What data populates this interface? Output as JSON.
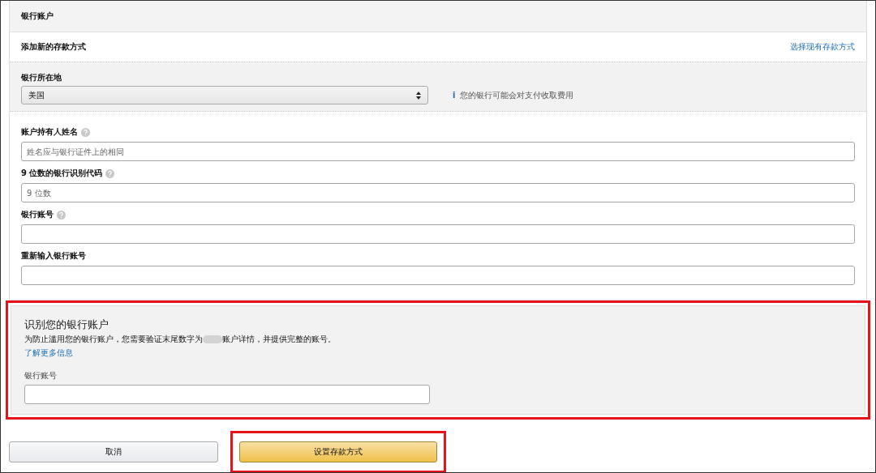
{
  "panel": {
    "title": "银行账户"
  },
  "method": {
    "title": "添加新的存款方式",
    "link": "选择现有存款方式"
  },
  "location": {
    "label": "银行所在地",
    "value": "美国",
    "note_icon": "i",
    "note": "您的银行可能会对支付收取费用"
  },
  "fields": [
    {
      "label": "账户持有人姓名",
      "help": true,
      "placeholder": "姓名应与银行证件上的相同"
    },
    {
      "label": "9 位数的银行识别代码",
      "help": true,
      "placeholder": "9 位数"
    },
    {
      "label": "银行账号",
      "help": true
    },
    {
      "label": "重新输入银行账号",
      "help": false
    }
  ],
  "verify": {
    "title": "识别您的银行账户",
    "text_before": "为防止滥用您的银行账户，您需要验证末尾数字为",
    "text_after": "账户详情，并提供完整的账号。",
    "link": "了解更多信息",
    "field_label": "银行账号",
    "highlighted": true
  },
  "buttons": [
    {
      "label": "取消",
      "kind": "secondary",
      "highlighted": false
    },
    {
      "label": "设置存款方式",
      "kind": "primary",
      "highlighted": true
    }
  ]
}
